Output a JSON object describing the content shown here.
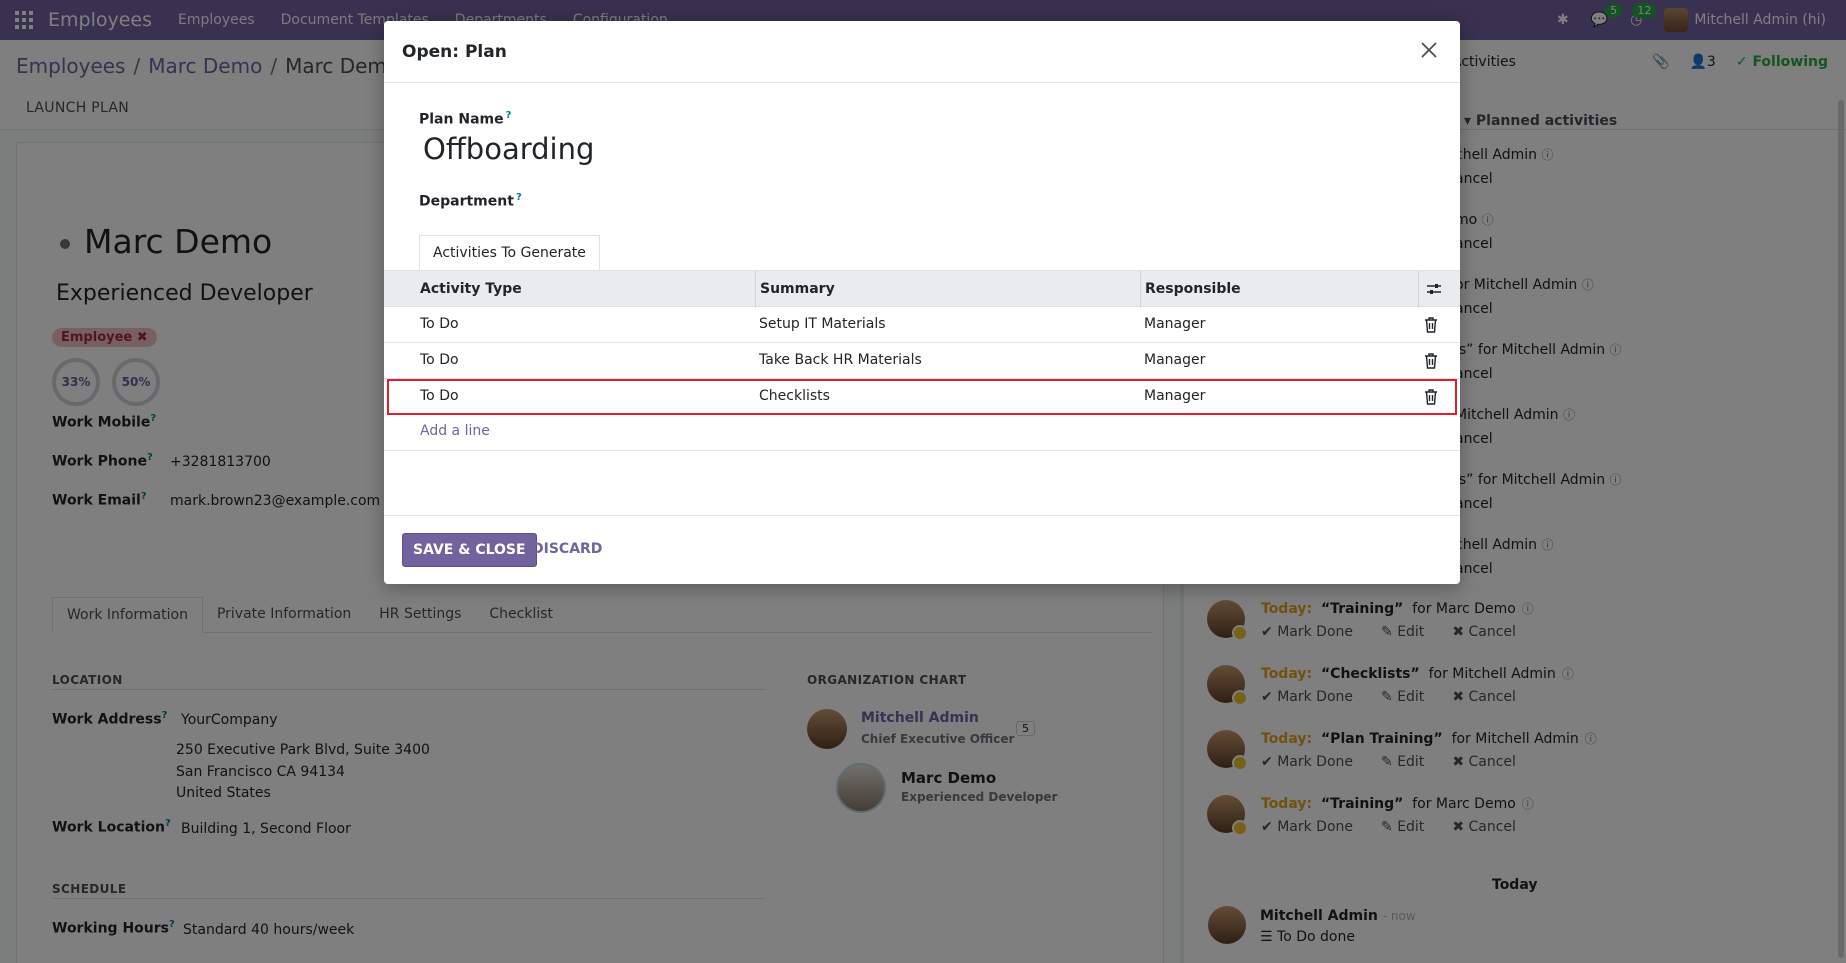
{
  "navbar": {
    "brand": "Employees",
    "menu": [
      "Employees",
      "Document Templates",
      "Departments",
      "Configuration"
    ],
    "messages_count": "5",
    "activities_count": "12",
    "user": "Mitchell Admin (hi)"
  },
  "breadcrumb": [
    "Employees",
    "Marc Demo",
    "Marc Demo"
  ],
  "toolbar": {
    "launch_plan": "LAUNCH PLAN",
    "activities": "Activities",
    "followers_count": "3",
    "following": "Following"
  },
  "employee": {
    "name": "Marc Demo",
    "job": "Experienced Developer",
    "tag": "Employee",
    "ring1": "33%",
    "ring2": "50%",
    "work_mobile_label": "Work Mobile",
    "work_phone_label": "Work Phone",
    "work_phone": "+3281813700",
    "work_email_label": "Work Email",
    "work_email": "mark.brown23@example.com"
  },
  "form_tabs": [
    "Work Information",
    "Private Information",
    "HR Settings",
    "Checklist"
  ],
  "work_info": {
    "location_title": "LOCATION",
    "work_address_label": "Work Address",
    "company": "YourCompany",
    "addr1": "250 Executive Park Blvd, Suite 3400",
    "addr2": "San Francisco CA 94134",
    "addr3": "United States",
    "work_location_label": "Work Location",
    "work_location": "Building 1, Second Floor",
    "schedule_title": "SCHEDULE",
    "working_hours_label": "Working Hours",
    "working_hours": "Standard 40 hours/week"
  },
  "org_chart": {
    "title": "ORGANIZATION CHART",
    "manager_name": "Mitchell Admin",
    "manager_title": "Chief Executive Officer",
    "manager_count": "5",
    "emp_name": "Marc Demo",
    "emp_title": "Experienced Developer"
  },
  "chatter": {
    "planned_title": "Planned activities",
    "partial_rows": [
      "chell Admin",
      "ancel",
      "mo",
      "ancel",
      "or Mitchell Admin",
      "ancel",
      "ls”  for Mitchell Admin",
      "ancel",
      "Mitchell Admin",
      "ancel",
      "ls”  for Mitchell Admin",
      "ancel",
      "chell Admin",
      "ancel"
    ],
    "activities": [
      {
        "today": "Today:",
        "summary": "“Training”",
        "for": "for Marc Demo"
      },
      {
        "today": "Today:",
        "summary": "“Checklists”",
        "for": "for Mitchell Admin"
      },
      {
        "today": "Today:",
        "summary": "“Plan Training”",
        "for": "for Mitchell Admin"
      },
      {
        "today": "Today:",
        "summary": "“Training”",
        "for": "for Marc Demo"
      }
    ],
    "mark_done": "Mark Done",
    "edit": "Edit",
    "cancel": "Cancel",
    "today_sep": "Today",
    "msg_author": "Mitchell Admin",
    "msg_time": "- now",
    "msg_body": "To Do done"
  },
  "modal": {
    "title": "Open: Plan",
    "plan_name_label": "Plan Name",
    "plan_name": "Offboarding",
    "department_label": "Department",
    "tab": "Activities To Generate",
    "columns": [
      "Activity Type",
      "Summary",
      "Responsible"
    ],
    "rows": [
      {
        "type": "To Do",
        "summary": "Setup IT Materials",
        "responsible": "Manager"
      },
      {
        "type": "To Do",
        "summary": "Take Back HR Materials",
        "responsible": "Manager"
      },
      {
        "type": "To Do",
        "summary": "Checklists",
        "responsible": "Manager"
      }
    ],
    "add_line": "Add a line",
    "save_close": "SAVE & CLOSE",
    "discard": "DISCARD"
  }
}
